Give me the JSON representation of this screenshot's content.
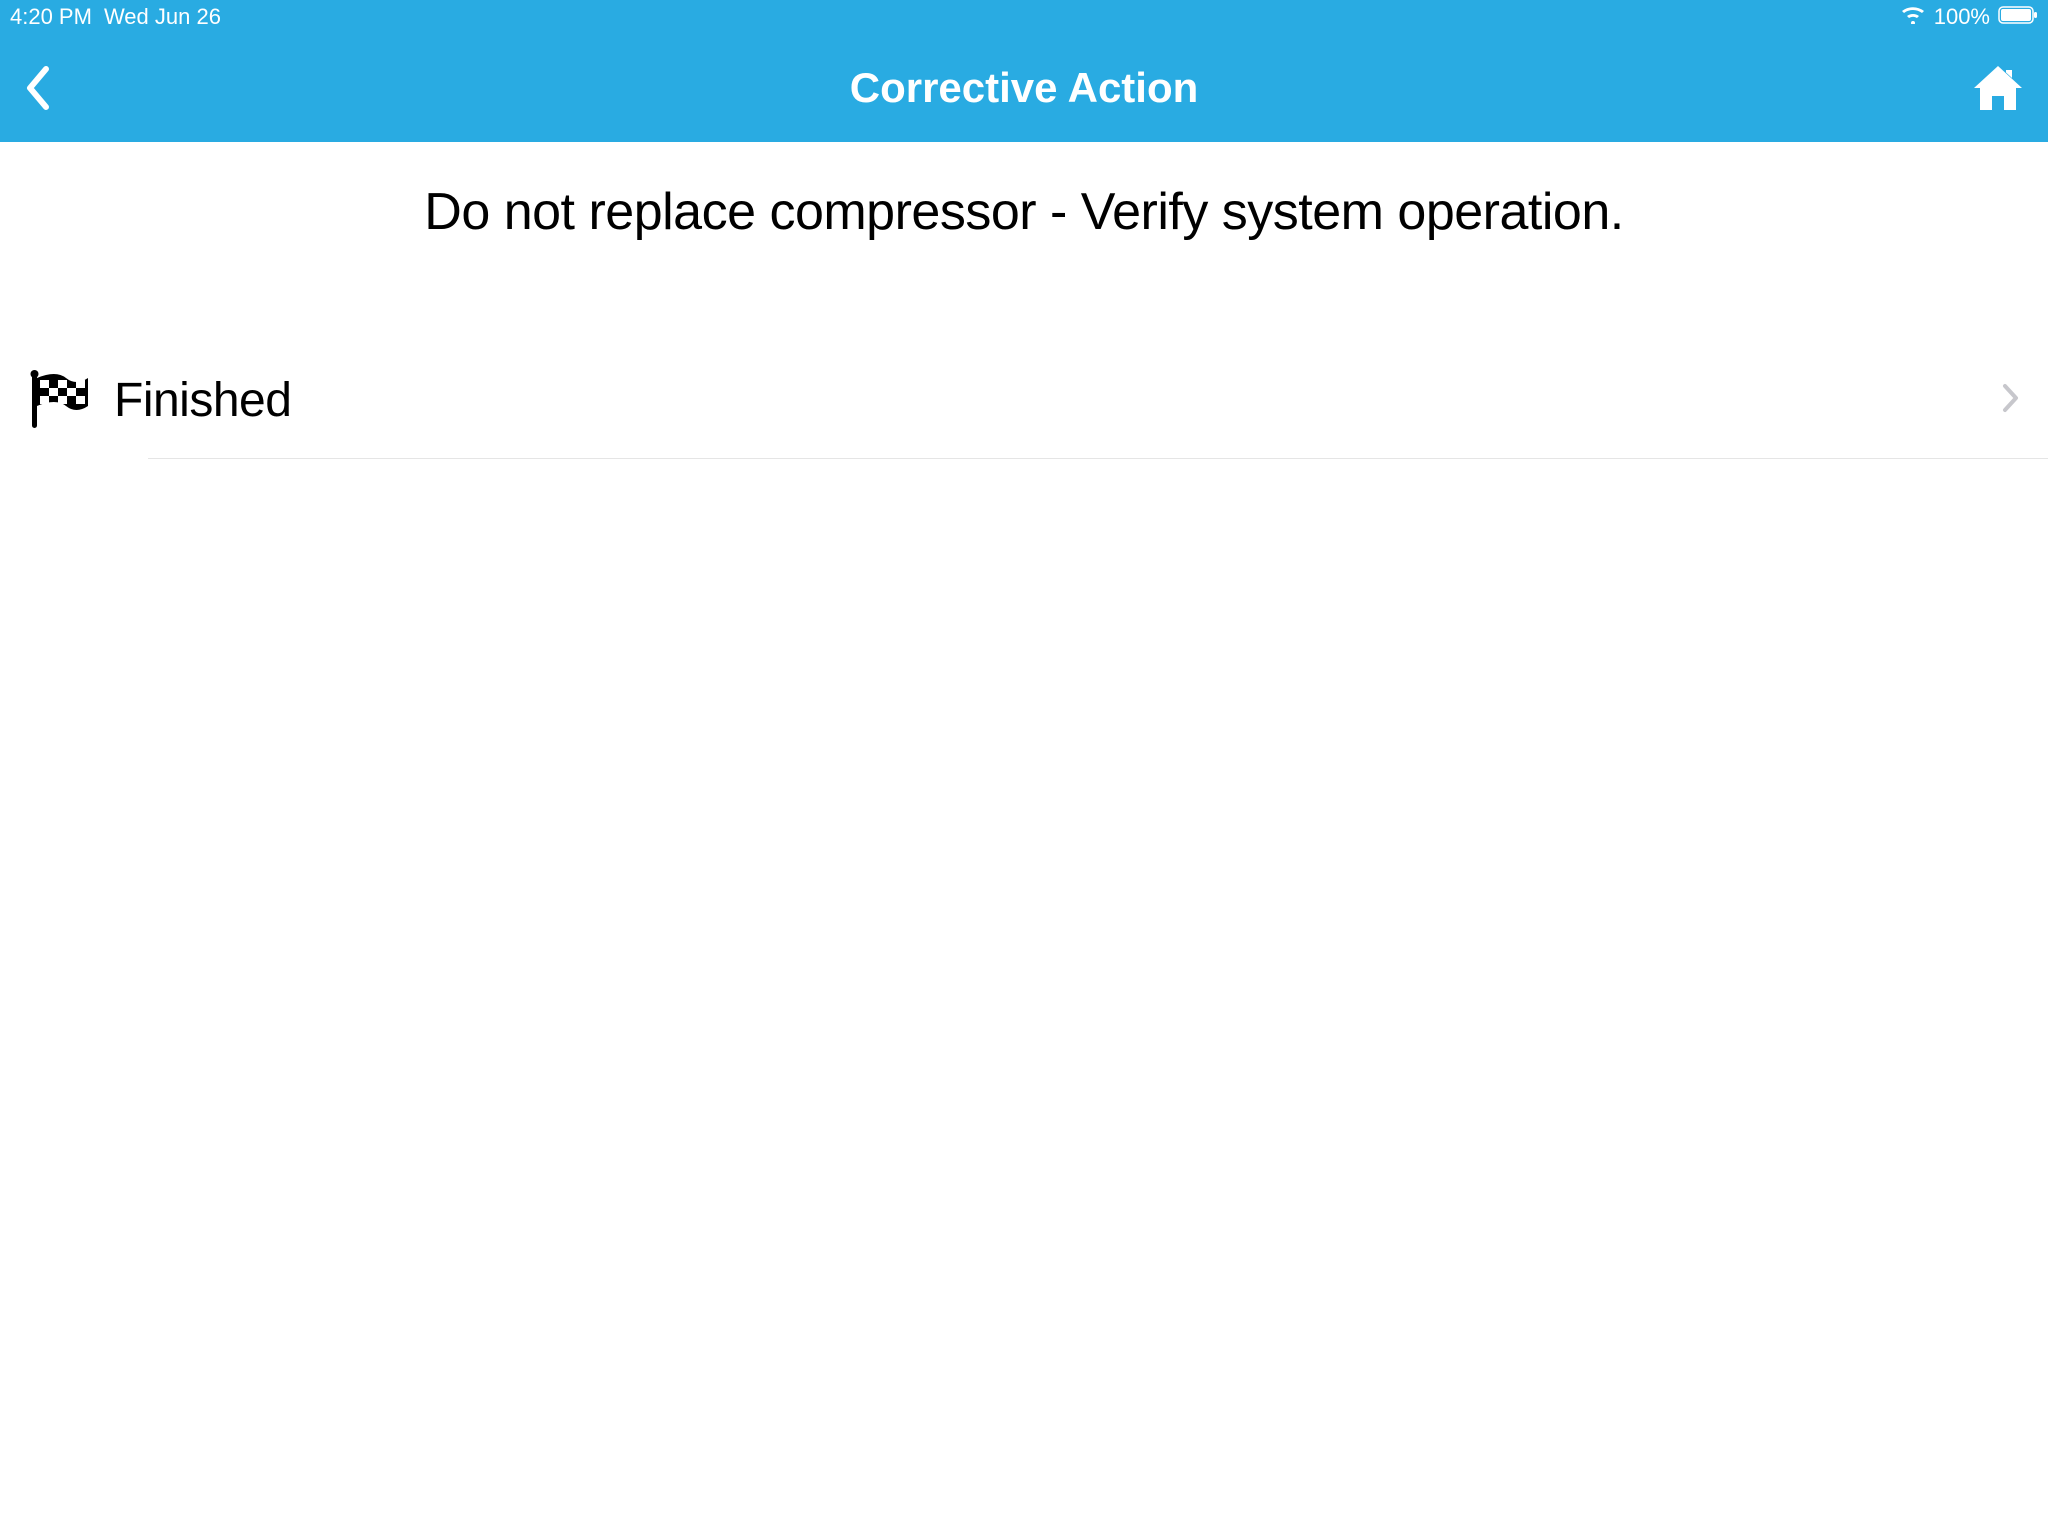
{
  "status_bar": {
    "time": "4:20 PM",
    "date": "Wed Jun 26",
    "battery": "100%"
  },
  "nav": {
    "title": "Corrective Action"
  },
  "content": {
    "instruction": "Do not replace compressor - Verify system operation."
  },
  "list": {
    "items": [
      {
        "label": "Finished"
      }
    ]
  }
}
